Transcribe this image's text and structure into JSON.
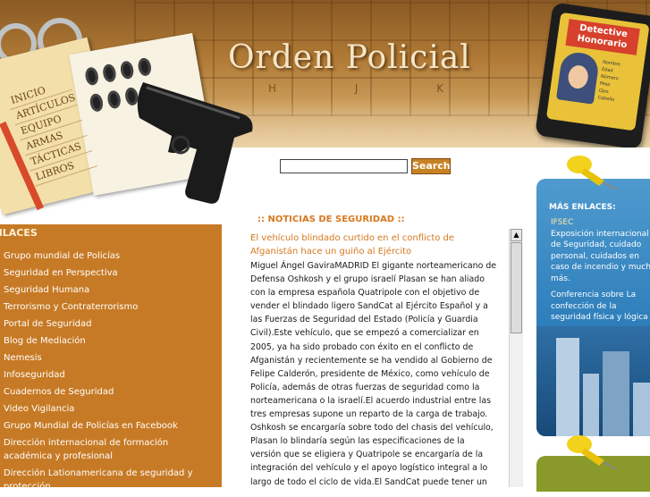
{
  "header": {
    "title": "Orden Policial",
    "key_letters": "H J K",
    "book_menu": [
      "Inicio",
      "Artículos",
      "Equipo",
      "Armas",
      "Tácticas",
      "Libros"
    ],
    "badge": {
      "title": "Detective Honorario",
      "lines": [
        "Nombre",
        "Edad",
        "Número",
        "Peso",
        "Ojos",
        "Cabello"
      ]
    }
  },
  "search": {
    "placeholder": "",
    "button_label": "Search"
  },
  "sidebar": {
    "heading": "ENLACES",
    "items": [
      "Grupo mundial de Policías",
      "Seguridad en Perspectiva",
      "Seguridad Humana",
      "Terrorismo y Contraterrorismo",
      "Portal de Seguridad",
      "Blog de Mediación",
      "Nemesis",
      "Infoseguridad",
      "Cuadernos de Seguridad",
      "Video Vigilancia",
      "Grupo Mundial de Policías en Facebook",
      "Dirección internacional de formación académica y profesional",
      "Dirección Lationamericana de seguridad y protección"
    ]
  },
  "news": {
    "heading": ":: NOTICIAS DE SEGURIDAD ::",
    "title": "El vehículo blindado curtido en el conflicto de Afganistán hace un guiño al Ejército",
    "body": "Miguel Ángel GaviraMADRID El gigante norteamericano de Defensa Oshkosh y el grupo israelí Plasan se han aliado con la empresa española Quatripole con el objetivo de vender el blindado ligero SandCat al Ejército Español y a las Fuerzas de Seguridad del Estado (Policía y Guardia Civil).Este vehículo, que se empezó a comercializar en 2005, ya ha sido probado con éxito en el conflicto de Afganistán y recientemente se ha vendido al Gobierno de Felipe Calderón, presidente de México, como vehículo de Policía, además de otras fuerzas de seguridad como la norteamericana o la israelí.El acuerdo industrial entre las tres empresas supone un reparto de la carga de trabajo. Oshkosh se encargaría sobre todo del chasis del vehículo, Plasan lo blindaría según las especificaciones de la versión que se eligiera y Quatripole se encargaría de la integración del vehículo y el apoyo logístico integral a lo largo de todo el ciclo de vida.El SandCat puede tener un peso máximo de siete toneladas y alcanzar una velocidad de 120 kilómetros por hora. También existe una"
  },
  "right_panel": {
    "heading": "MÁS ENLACES:",
    "links": [
      {
        "title": "IFSEC",
        "text": "Exposición internacional de Seguridad, cuidado personal, cuidados en caso de incendio y mucho más."
      },
      {
        "title": "",
        "text": "Conferencia sobre La confección de la seguridad física y lógica"
      }
    ]
  },
  "colors": {
    "accent": "#d6781f",
    "sidebar_bg": "#c77a25",
    "right_panel_bg": "#2f7fbc",
    "search_button": "#c78224"
  }
}
